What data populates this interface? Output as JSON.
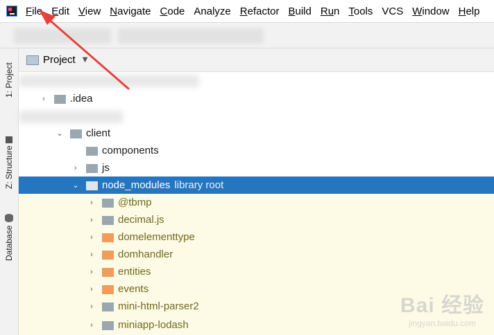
{
  "menu": {
    "items": [
      {
        "key": "F",
        "rest": "ile"
      },
      {
        "key": "E",
        "rest": "dit"
      },
      {
        "key": "V",
        "rest": "iew"
      },
      {
        "key": "N",
        "rest": "avigate"
      },
      {
        "key": "C",
        "rest": "ode"
      },
      {
        "key": "",
        "rest": "Analyze"
      },
      {
        "key": "R",
        "rest": "efactor"
      },
      {
        "key": "B",
        "rest": "uild"
      },
      {
        "key": "R",
        "rest": "u",
        "tail": "n"
      },
      {
        "key": "T",
        "rest": "ools"
      },
      {
        "key": "",
        "rest": "VCS"
      },
      {
        "key": "W",
        "rest": "indow"
      },
      {
        "key": "H",
        "rest": "elp"
      }
    ]
  },
  "left_tabs": {
    "project": "1: Project",
    "structure": "Z: Structure",
    "database": "Database"
  },
  "panel": {
    "title": "Project"
  },
  "tree": {
    "rows": [
      {
        "name": ".idea"
      },
      {
        "name": "client"
      },
      {
        "name": "components"
      },
      {
        "name": "js"
      },
      {
        "name": "node_modules",
        "suffix": "library root"
      },
      {
        "name": "@tbmp"
      },
      {
        "name": "decimal.js"
      },
      {
        "name": "domelementtype"
      },
      {
        "name": "domhandler"
      },
      {
        "name": "entities"
      },
      {
        "name": "events"
      },
      {
        "name": "mini-html-parser2"
      },
      {
        "name": "miniapp-lodash"
      }
    ]
  },
  "watermark": {
    "main": "Bai  经验",
    "sub": "jingyan.baidu.com"
  },
  "colors": {
    "selection": "#2675bf",
    "library_bg": "#fdfbe6",
    "arrow": "#e8413a",
    "folder_gray": "#9aa7b0",
    "folder_orange": "#f19b5c"
  }
}
